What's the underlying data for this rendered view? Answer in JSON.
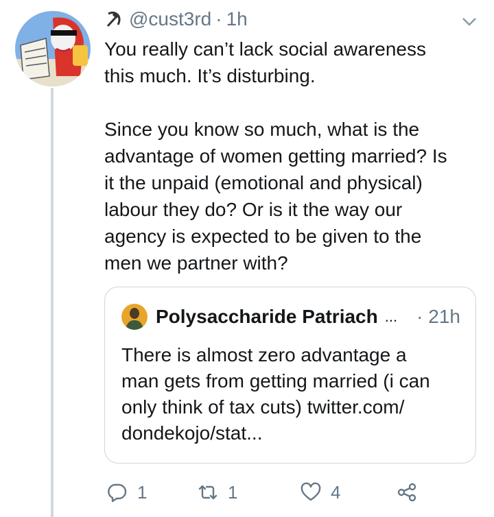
{
  "tweet": {
    "handle": "@cust3rd",
    "separator": "·",
    "time": "1h",
    "text_paragraphs": [
      "You really can’t lack social awareness\nthis much. It’s disturbing.",
      "Since you know so much, what is the\nadvantage of women getting married? Is\nit the unpaid (emotional and physical)\nlabour they do? Or is it the way our\nagency is expected to be given to the\nmen we partner with?"
    ]
  },
  "quote": {
    "name": "Polysaccharide Patriach",
    "ellipsis": "...",
    "time": "· 21h",
    "text": "There is almost zero advantage a\nman gets from getting married (i can\nonly think of tax cuts) twitter.com/\ndondekojo/stat..."
  },
  "actions": {
    "reply_count": "1",
    "retweet_count": "1",
    "like_count": "4"
  },
  "icons": [
    "hammer-sickle-icon",
    "chevron-down-icon",
    "reply-icon",
    "retweet-icon",
    "like-icon",
    "share-icon"
  ],
  "colors": {
    "secondary_text": "#657786",
    "border": "#ccd6dd",
    "thread_line": "#cfd9de"
  }
}
